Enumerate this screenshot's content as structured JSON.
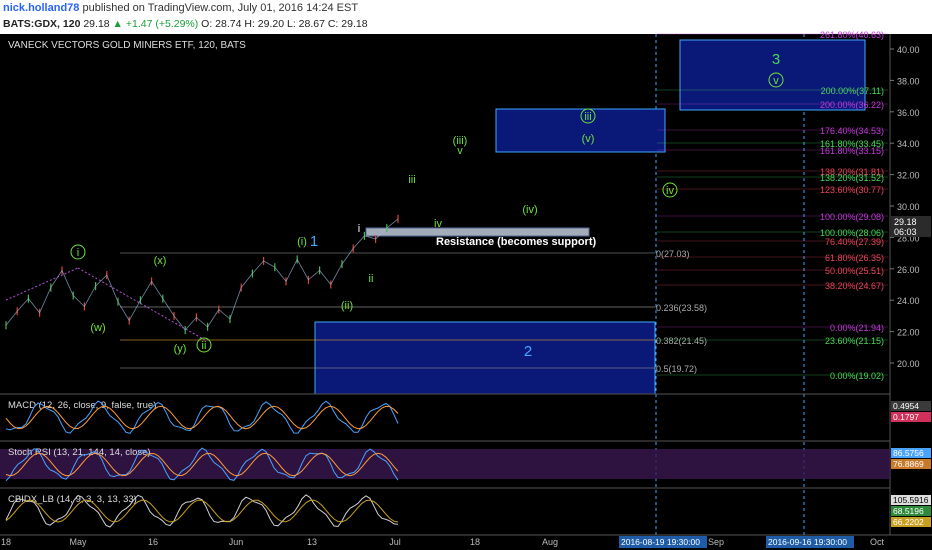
{
  "header": {
    "username": "nick.holland78",
    "published": " published on TradingView.com, July 01, 2016 14:24 EST",
    "symbol": "BATS:GDX, 120",
    "last": "29.18",
    "change": "▲ +1.47 (+5.29%)",
    "ohlc": "O: 28.74 H: 29.20 L: 28.67 C: 29.18"
  },
  "chart_title": "VANECK VECTORS GOLD MINERS ETF, 120, BATS",
  "colors": {
    "background": "#000000",
    "green_labels": "#6fe23a",
    "blue_box": "#1a2aa8",
    "fib_purple": "#c13bd9",
    "fib_red": "#e8455a",
    "fib_green": "#49d65a"
  },
  "chart_data": [
    {
      "type": "line",
      "name": "price",
      "x_ticks": [
        "18",
        "May",
        "16",
        "Jun",
        "13",
        "Jul",
        "18",
        "Aug",
        "Sep",
        "Oct"
      ],
      "y_ticks": [
        20.0,
        22.0,
        24.0,
        26.0,
        28.0,
        30.0,
        32.0,
        34.0,
        36.0,
        38.0,
        40.0
      ],
      "ylim": [
        18.0,
        41.0
      ],
      "last_price_badge": "29.18",
      "secondary_badge": "06:03",
      "date_badges": [
        "2016-08-19 19:30:00",
        "2016-09-16 19:30:00"
      ],
      "wave_labels": [
        "i",
        "(w)",
        "(x)",
        "(y)",
        "ii",
        "(i)",
        "1",
        "(ii)",
        "i",
        "ii",
        "(iii)",
        "v",
        "iii",
        "iv",
        "(iv)",
        "iii",
        "(v)",
        "iv",
        "3",
        "v",
        "2"
      ],
      "resistance_label": "Resistance (becomes support)",
      "fib_left": [
        "0(27.03)",
        "0.236(23.58)",
        "0.382(21.45)",
        "0.5(19.72)"
      ],
      "fib_right": [
        "261.80%(40.63)",
        "200.00%(37.11)",
        "200.00%(36.22)",
        "176.40%(34.53)",
        "161.80%(33.45)",
        "161.80%(33.15)",
        "138.20%(31.81)",
        "138.20%(31.52)",
        "123.60%(30.77)",
        "100.00%(29.08)",
        "100.00%(28.06)",
        "76.40%(27.39)",
        "61.80%(26.35)",
        "50.00%(25.51)",
        "38.20%(24.67)",
        "0.00%(21.94)",
        "23.60%(21.15)",
        "0.00%(19.02)"
      ],
      "approx_closes": [
        22.4,
        23.3,
        24.1,
        23.2,
        24.8,
        25.9,
        24.3,
        23.6,
        24.9,
        25.6,
        23.9,
        22.7,
        24.0,
        25.2,
        24.1,
        23.0,
        22.1,
        22.9,
        22.3,
        23.4,
        22.8,
        24.8,
        25.7,
        26.5,
        26.1,
        25.2,
        26.6,
        25.3,
        25.9,
        25.0,
        26.3,
        27.3,
        28.1,
        27.9,
        28.6,
        29.18
      ]
    },
    {
      "type": "line",
      "name": "MACD (12, 26, close, 9, false, true)",
      "badges": [
        "0.4954",
        "0.1797"
      ]
    },
    {
      "type": "line",
      "name": "Stoch RSI (13, 21, 144, 14, close)",
      "badges": [
        "86.5756",
        "76.8869"
      ]
    },
    {
      "type": "line",
      "name": "CBIDX_LB (14, 9, 3, 3, 13, 33)",
      "badges": [
        "105.5916",
        "68.5196",
        "66.2202"
      ]
    }
  ]
}
